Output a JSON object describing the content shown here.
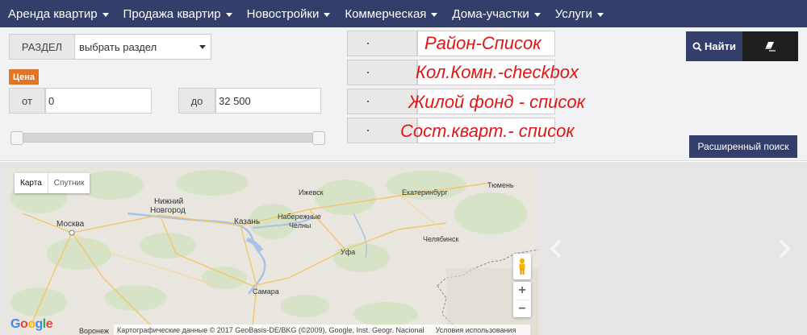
{
  "nav": {
    "items": [
      {
        "label": "Аренда квартир"
      },
      {
        "label": "Продажа квартир"
      },
      {
        "label": "Новостройки"
      },
      {
        "label": "Коммерческая"
      },
      {
        "label": "Дома-участки"
      },
      {
        "label": "Услуги"
      }
    ]
  },
  "search": {
    "section_label": "РАЗДЕЛ",
    "section_select_value": "выбрать раздел",
    "price_badge": "Цена",
    "from_label": "от",
    "from_value": "0",
    "to_label": "до",
    "to_value": "32 500",
    "slider": {
      "min_fraction": 0,
      "max_fraction": 1
    },
    "annotations": {
      "district": "Район-Список",
      "rooms": "Кол.Комн.-checkbox",
      "housing": "Жилой фонд - список",
      "condition": "Сост.кварт.- список"
    },
    "find_button": "Найти",
    "advanced_button": "Расширенный поиск"
  },
  "map": {
    "type_map": "Карта",
    "type_satellite": "Спутник",
    "cities": {
      "moscow": "Москва",
      "nizhny_1": "Нижний",
      "nizhny_2": "Новгород",
      "kazan": "Казань",
      "izhevsk": "Ижевск",
      "chelny_1": "Набережные",
      "chelny_2": "Челны",
      "ekaterinburg": "Екатеринбург",
      "tyumen": "Тюмень",
      "chelyabinsk": "Челябинск",
      "ufa": "Уфа",
      "samara": "Самара",
      "voronezh": "Воронеж"
    },
    "zoom_in": "+",
    "zoom_out": "−",
    "google": "Google",
    "attribution": "Картографические данные © 2017 GeoBasis-DE/BKG (©2009), Google, Inst. Geogr. Nacional",
    "terms": "Условия использования"
  },
  "colors": {
    "nav_bg": "#343e6a",
    "accent_orange": "#e07428",
    "annotation_red": "#e31414"
  }
}
